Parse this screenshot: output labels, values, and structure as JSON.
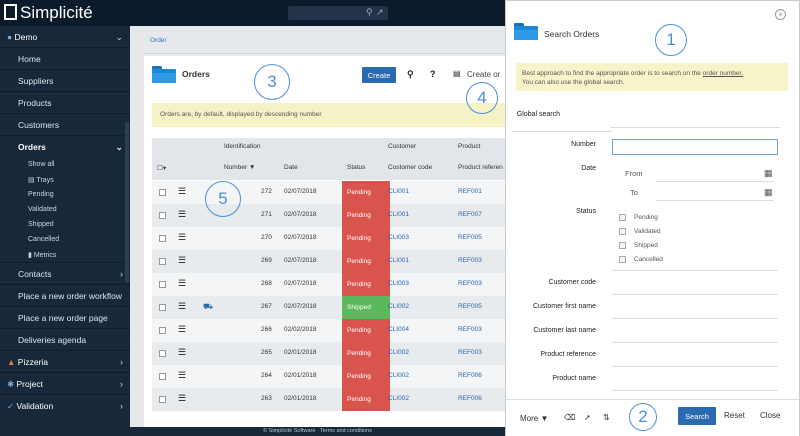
{
  "app": {
    "logo": "Simplicité"
  },
  "sidebar": {
    "demo": "Demo",
    "items": [
      "Home",
      "Suppliers",
      "Products",
      "Customers"
    ],
    "orders": "Orders",
    "orders_sub": [
      "Show all",
      "Trays",
      "Pending",
      "Validated",
      "Shipped",
      "Cancelled",
      "Metrics"
    ],
    "after": [
      "Contacts",
      "Place a new order workflow",
      "Place a new order page",
      "Deliveries agenda"
    ],
    "groups": [
      "Pizzeria",
      "Project",
      "Validation"
    ]
  },
  "main": {
    "breadcrumb": "Order",
    "title": "Orders",
    "create_label": "Create",
    "create_other_label": "Create or",
    "info": "Orders are, by default, displayed by descending number",
    "headers_top": {
      "identification": "Identification",
      "customer": "Customer",
      "product": "Product"
    },
    "headers": {
      "number": "Number",
      "date": "Date",
      "status": "Status",
      "customer_code": "Customer code",
      "product_ref": "Product referen"
    },
    "rows": [
      {
        "number": "272",
        "date": "02/07/2018",
        "status": "Pending",
        "customer": "CLI001",
        "product": "REF001"
      },
      {
        "number": "271",
        "date": "02/07/2018",
        "status": "Pending",
        "customer": "CLI001",
        "product": "REF007"
      },
      {
        "number": "270",
        "date": "02/07/2018",
        "status": "Pending",
        "customer": "CLI003",
        "product": "REF005"
      },
      {
        "number": "269",
        "date": "02/07/2018",
        "status": "Pending",
        "customer": "CLI001",
        "product": "REF003"
      },
      {
        "number": "268",
        "date": "02/07/2018",
        "status": "Pending",
        "customer": "CLI003",
        "product": "REF003"
      },
      {
        "number": "267",
        "date": "02/07/2018",
        "status": "Shipped",
        "customer": "CLI002",
        "product": "REF005"
      },
      {
        "number": "266",
        "date": "02/02/2018",
        "status": "Pending",
        "customer": "CLI004",
        "product": "REF003"
      },
      {
        "number": "265",
        "date": "02/01/2018",
        "status": "Pending",
        "customer": "CLI002",
        "product": "REF003"
      },
      {
        "number": "264",
        "date": "02/01/2018",
        "status": "Pending",
        "customer": "CLI002",
        "product": "REF006"
      },
      {
        "number": "263",
        "date": "02/01/2018",
        "status": "Pending",
        "customer": "CLI002",
        "product": "REF006"
      }
    ]
  },
  "dialog": {
    "title": "Search Orders",
    "info_text": "Best approach to find the appropriate order is to search on the ",
    "info_link": "order number.",
    "info_text2": "You can also use the global search.",
    "global_search": "Global search",
    "number": "Number",
    "date": "Date",
    "from": "From",
    "to": "To",
    "status": "Status",
    "statuses": [
      "Pending",
      "Validated",
      "Shipped",
      "Cancelled"
    ],
    "customer_code": "Customer code",
    "customer_first": "Customer first name",
    "customer_last": "Customer last name",
    "product_ref": "Product reference",
    "product_name": "Product name",
    "more": "More",
    "search": "Search",
    "reset": "Reset",
    "close": "Close"
  },
  "callouts": [
    "1",
    "2",
    "3",
    "4",
    "5"
  ],
  "footer": {
    "copyright": "© Simplicité Software",
    "terms": "Terms and conditions"
  },
  "colors": {
    "pending": "#d9534f",
    "shipped": "#5cb85c",
    "accent": "#2a6ab0",
    "sidebar": "#16283a"
  }
}
